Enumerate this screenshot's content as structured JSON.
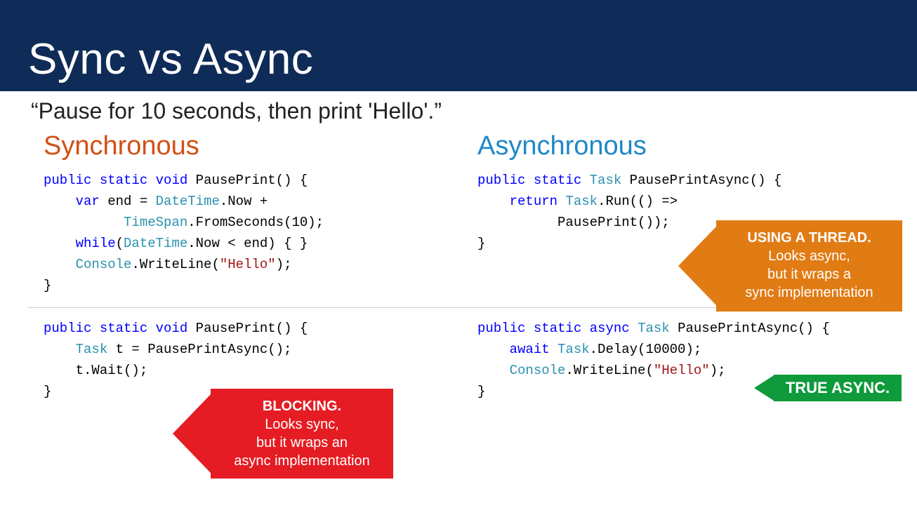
{
  "title": "Sync vs Async",
  "subtitle": "“Pause for 10 seconds, then print 'Hello'.”",
  "headings": {
    "sync": "Synchronous",
    "async": "Asynchronous"
  },
  "code": {
    "sync_top": {
      "tokens": [
        {
          "t": "public",
          "c": "kw"
        },
        {
          "t": " "
        },
        {
          "t": "static",
          "c": "kw"
        },
        {
          "t": " "
        },
        {
          "t": "void",
          "c": "kw"
        },
        {
          "t": " PausePrint() {\n    "
        },
        {
          "t": "var",
          "c": "kw"
        },
        {
          "t": " end = "
        },
        {
          "t": "DateTime",
          "c": "typ"
        },
        {
          "t": ".Now +\n          "
        },
        {
          "t": "TimeSpan",
          "c": "typ"
        },
        {
          "t": ".FromSeconds(10);\n    "
        },
        {
          "t": "while",
          "c": "kw"
        },
        {
          "t": "("
        },
        {
          "t": "DateTime",
          "c": "typ"
        },
        {
          "t": ".Now < end) { }\n    "
        },
        {
          "t": "Console",
          "c": "typ"
        },
        {
          "t": ".WriteLine("
        },
        {
          "t": "\"Hello\"",
          "c": "str"
        },
        {
          "t": ");\n}"
        }
      ]
    },
    "async_top": {
      "tokens": [
        {
          "t": "public",
          "c": "kw"
        },
        {
          "t": " "
        },
        {
          "t": "static",
          "c": "kw"
        },
        {
          "t": " "
        },
        {
          "t": "Task",
          "c": "typ"
        },
        {
          "t": " PausePrintAsync() {\n    "
        },
        {
          "t": "return",
          "c": "kw"
        },
        {
          "t": " "
        },
        {
          "t": "Task",
          "c": "typ"
        },
        {
          "t": ".Run(() =>\n          PausePrint());\n}"
        }
      ]
    },
    "sync_bottom": {
      "tokens": [
        {
          "t": "public",
          "c": "kw"
        },
        {
          "t": " "
        },
        {
          "t": "static",
          "c": "kw"
        },
        {
          "t": " "
        },
        {
          "t": "void",
          "c": "kw"
        },
        {
          "t": " PausePrint() {\n    "
        },
        {
          "t": "Task",
          "c": "typ"
        },
        {
          "t": " t = PausePrintAsync();\n    t.Wait();\n}"
        }
      ]
    },
    "async_bottom": {
      "tokens": [
        {
          "t": "public",
          "c": "kw"
        },
        {
          "t": " "
        },
        {
          "t": "static",
          "c": "kw"
        },
        {
          "t": " "
        },
        {
          "t": "async",
          "c": "kw"
        },
        {
          "t": " "
        },
        {
          "t": "Task",
          "c": "typ"
        },
        {
          "t": " PausePrintAsync() {\n    "
        },
        {
          "t": "await",
          "c": "kw"
        },
        {
          "t": " "
        },
        {
          "t": "Task",
          "c": "typ"
        },
        {
          "t": ".Delay(10000);\n    "
        },
        {
          "t": "Console",
          "c": "typ"
        },
        {
          "t": ".WriteLine("
        },
        {
          "t": "\"Hello\"",
          "c": "str"
        },
        {
          "t": ");\n}"
        }
      ]
    }
  },
  "callouts": {
    "red": {
      "bold": "BLOCKING.",
      "rest": "Looks sync,\nbut it wraps an\nasync implementation"
    },
    "orange": {
      "bold": "USING A THREAD.",
      "rest": "Looks async,\nbut it wraps a\nsync implementation"
    },
    "green": {
      "bold": "TRUE ASYNC."
    }
  }
}
